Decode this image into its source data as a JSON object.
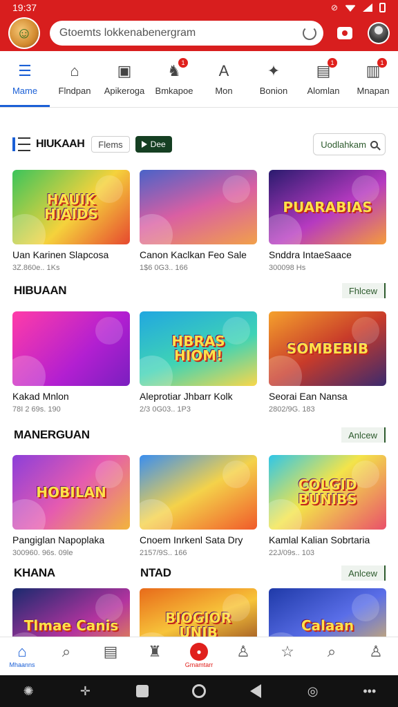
{
  "status_bar": {
    "time": "19:37"
  },
  "app_bar": {
    "search_text": "Gtoemts lokkenabenergram"
  },
  "categories": [
    {
      "label": "Mame",
      "icon": "menu-icon",
      "glyph": "☰",
      "badge": ""
    },
    {
      "label": "Flndpan",
      "icon": "home-icon",
      "glyph": "⌂",
      "badge": ""
    },
    {
      "label": "Apikeroga",
      "icon": "gallery-icon",
      "glyph": "▣",
      "badge": ""
    },
    {
      "label": "Bmkapoe",
      "icon": "rocket-icon",
      "glyph": "♞",
      "badge": "1"
    },
    {
      "label": "Mon",
      "icon": "letter-a-icon",
      "glyph": "A",
      "badge": ""
    },
    {
      "label": "Bonion",
      "icon": "puzzle-icon",
      "glyph": "✦",
      "badge": ""
    },
    {
      "label": "Alomlan",
      "icon": "gift-icon",
      "glyph": "▤",
      "badge": "1"
    },
    {
      "label": "Mnapan",
      "icon": "chart-icon",
      "glyph": "▥",
      "badge": "1"
    }
  ],
  "filters": {
    "title": "HIUKAAH",
    "chip_label": "Flems",
    "play_chip_label": "Dee",
    "sort_label": "Uodlahkam"
  },
  "sections": [
    {
      "title": "",
      "see_all": "",
      "cards": [
        {
          "thumb_text": "HAUIK HIAIDS",
          "title": "Uan Karinen Slapcosa",
          "meta": "3Z.860e.. 1Ks",
          "bg": "linear-gradient(135deg,#3bc45b,#f5d23c 55%,#e6482f)"
        },
        {
          "thumb_text": "",
          "title": "Canon Kaclkan Feo Sale",
          "meta": "1$6 0G3.. 166",
          "bg": "linear-gradient(160deg,#4a63c8,#d95fa3 50%,#f1a04a)"
        },
        {
          "thumb_text": "PUARABIAS",
          "title": "Snddra IntaeSaace",
          "meta": "300098 Hs",
          "bg": "linear-gradient(150deg,#2a1b6e,#b63ac0 55%,#f59c3a)"
        }
      ]
    },
    {
      "title": "HIBUAAN",
      "see_all": "Fhlcew",
      "cards": [
        {
          "thumb_text": "",
          "title": "Kakad Mnlon",
          "meta": "78I 2 69s. 190",
          "bg": "linear-gradient(135deg,#ff3ca8,#b21fd1 60%,#7a1fbf)"
        },
        {
          "thumb_text": "HBRAS HIOM!",
          "title": "Aleprotiar Jhbarr Kolk",
          "meta": "2/3 0G03.. 1P3",
          "bg": "linear-gradient(160deg,#21a7e0,#3fd3b5 55%,#f9d74a)"
        },
        {
          "thumb_text": "SOMBEBIB",
          "title": "Seorai Ean Nansa",
          "meta": "2802/9G. 183",
          "bg": "linear-gradient(150deg,#f5a12c,#c83b2a 50%,#3b2a6e)"
        }
      ]
    },
    {
      "title": "MANERGUAN",
      "see_all": "Anlcew",
      "cards": [
        {
          "thumb_text": "HOBILAN",
          "title": "Pangiglan Napoplaka",
          "meta": "300960. 96s. 09le",
          "bg": "linear-gradient(135deg,#8c3fd9,#e55bb0 50%,#f2b43c)"
        },
        {
          "thumb_text": "",
          "title": "Cnoem Inrkenl Sata Dry",
          "meta": "2157/9S.. 166",
          "bg": "linear-gradient(150deg,#3a8ef0,#f4d24a 50%,#f05a2a)"
        },
        {
          "thumb_text": "COLGID BUNIBS",
          "title": "Kamlal Kalian Sobrtaria",
          "meta": "22J/09s.. 103",
          "bg": "linear-gradient(140deg,#2fc6e8,#f3e44a 45%,#e9506a)"
        }
      ]
    },
    {
      "title": "KHANA",
      "title_2": "NTAD",
      "see_all": "Anlcew",
      "cards": [
        {
          "thumb_text": "Tlmae Canis",
          "title": "",
          "meta": "",
          "bg": "linear-gradient(150deg,#1a2a6e,#b3349f 55%,#f2a23a)"
        },
        {
          "thumb_text": "BIOGIOR UNIB",
          "title": "",
          "meta": "",
          "bg": "linear-gradient(160deg,#e86a1a,#f7c43a 45%,#7a2a1a)"
        },
        {
          "thumb_text": "Calaan",
          "title": "",
          "meta": "",
          "bg": "linear-gradient(150deg,#1f3aa8,#5a6ee8 50%,#f1c04a)"
        }
      ]
    }
  ],
  "bottom_nav": [
    {
      "label": "Mhaanns",
      "icon": "home-icon",
      "glyph": "⌂"
    },
    {
      "label": "",
      "icon": "search-icon",
      "glyph": "⌕"
    },
    {
      "label": "",
      "icon": "document-icon",
      "glyph": "▤"
    },
    {
      "label": "",
      "icon": "shopping-bag-icon",
      "glyph": "♜"
    },
    {
      "label": "Gmamtarr",
      "icon": "record-icon",
      "glyph": "●"
    },
    {
      "label": "",
      "icon": "profile-icon",
      "glyph": "♙"
    },
    {
      "label": "",
      "icon": "star-icon",
      "glyph": "☆"
    },
    {
      "label": "",
      "icon": "search-icon",
      "glyph": "⌕"
    },
    {
      "label": "",
      "icon": "user-icon",
      "glyph": "♙"
    }
  ],
  "colors": {
    "brand_red": "#d81e1e",
    "active_blue": "#1a5fd6",
    "see_all_green": "#2c5a2c"
  }
}
